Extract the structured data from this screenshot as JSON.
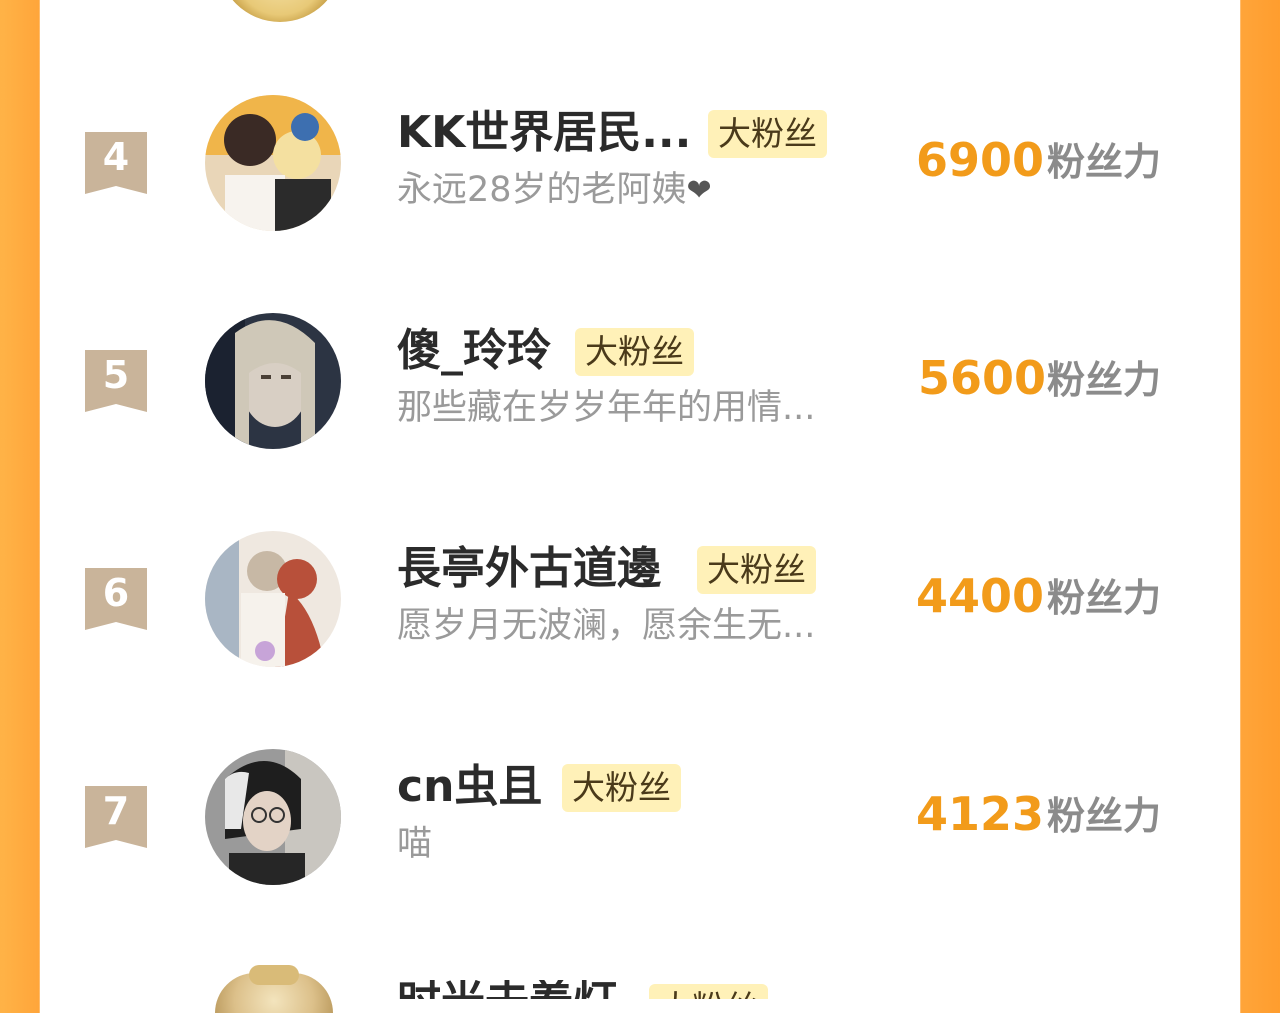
{
  "badge_label": "大粉丝",
  "score_unit": "粉丝力",
  "colors": {
    "accent": "#f29b1a",
    "badge_bg": "#fff1b8",
    "rank_badge": "#c9b49a",
    "frame": "#ffa53a"
  },
  "rows": [
    {
      "rank": "4",
      "name": "KK世界居民...",
      "bio": "永远28岁的老阿姨",
      "bio_icon": "heart-icon",
      "score": "6900"
    },
    {
      "rank": "5",
      "name": "傻_玲玲",
      "bio": "那些藏在岁岁年年的用情...",
      "score": "5600"
    },
    {
      "rank": "6",
      "name": "長亭外古道邊",
      "bio": "愿岁月无波澜，愿余生无...",
      "score": "4400"
    },
    {
      "rank": "7",
      "name": "cn虫且",
      "bio": "喵",
      "score": "4123"
    }
  ],
  "partial_next_row": {
    "name": "时光去羞灯",
    "badge": "大粉丝"
  }
}
